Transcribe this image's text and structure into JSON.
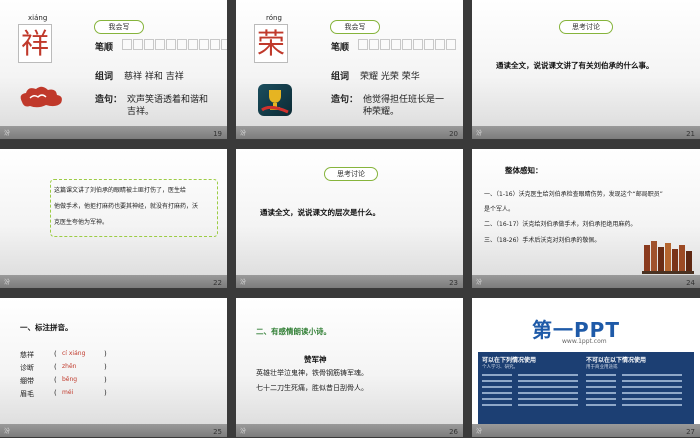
{
  "slides": {
    "s19": {
      "pinyin": "xiáng",
      "char": "祥",
      "pill": "我会写",
      "l1": "笔顺",
      "l2": "组词",
      "v2": "慈祥 祥和 吉祥",
      "l3": "造句：",
      "v3a": "欢声笑语透着和谐和",
      "v3b": "吉祥。",
      "num": "19",
      "footer": "汾"
    },
    "s20": {
      "pinyin": "róng",
      "char": "荣",
      "pill": "我会写",
      "l1": "笔顺",
      "l2": "组词",
      "v2": "荣耀 光荣 荣华",
      "l3": "造句：",
      "v3a": "他觉得担任班长是一",
      "v3b": "种荣耀。",
      "num": "20",
      "footer": "汾"
    },
    "s21": {
      "pill": "思考讨论",
      "text": "通读全文，说说课文讲了有关刘伯承的什么事。",
      "num": "21",
      "footer": "汾"
    },
    "s22": {
      "l1": "这篇课文讲了刘伯承的眼睛被土匪打伤了，医生给",
      "l2": "他做手术，他拒打麻药也要其神经，就没有打麻药，沃",
      "l3": "克医生夸他为军神。",
      "num": "22",
      "footer": "汾"
    },
    "s23": {
      "pill": "思考讨论",
      "text": "通读全文，说说课文的层次是什么。",
      "num": "23",
      "footer": "汾"
    },
    "s24": {
      "title": "整体感知：",
      "p1a": "一、（1-16）沃克医生给刘伯承检查眼睛伤势，发现这个“邮局职员”",
      "p1b": "是个军人。",
      "p2": "二、（16-17）沃克给刘伯承做手术，刘伯承拒绝用麻药。",
      "p3": "三、（18-26）手术后沃克对刘伯承的敬佩。",
      "num": "24",
      "footer": "汾"
    },
    "s25": {
      "title": "一、标注拼音。",
      "rows": [
        {
          "word": "慈祥",
          "py": "cí xiáng"
        },
        {
          "word": "诊断",
          "py": "zhěn"
        },
        {
          "word": "绷带",
          "py": "bēng"
        },
        {
          "word": "眉毛",
          "py": "méi"
        }
      ],
      "num": "25",
      "footer": "汾"
    },
    "s26": {
      "title": "二、有感情朗读小诗。",
      "poem_title": "赞军神",
      "line1": "英雄壮举泣鬼神，铁骨钢筋铸军魂。",
      "line2": "七十二刀生死痛，胜似昔日刮骨人。",
      "num": "26",
      "footer": "汾"
    },
    "s27": {
      "logo": "第一PPT",
      "url": "www.1ppt.com",
      "left_h": "可以在下列情况使用",
      "right_h": "不可以在以下情况使用",
      "left_sub1": "个人学习、研究。",
      "right_sub1": "用于商业用途或",
      "num": "27",
      "footer": "汾"
    }
  }
}
